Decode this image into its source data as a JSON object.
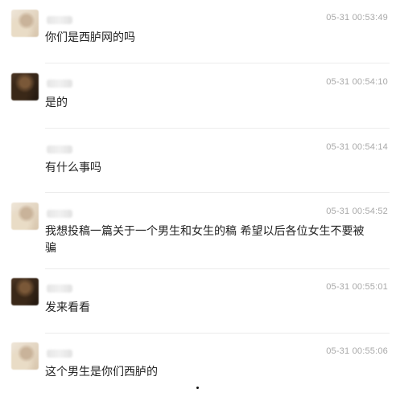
{
  "messages": [
    {
      "avatar": "light",
      "time": "05-31 00:53:49",
      "text": "你们是西胪网的吗"
    },
    {
      "avatar": "dark",
      "time": "05-31 00:54:10",
      "text": "是的"
    },
    {
      "avatar": "none",
      "time": "05-31 00:54:14",
      "text": "有什么事吗"
    },
    {
      "avatar": "light",
      "time": "05-31 00:54:52",
      "text": "我想投稿一篇关于一个男生和女生的稿 希望以后各位女生不要被骗"
    },
    {
      "avatar": "dark",
      "time": "05-31 00:55:01",
      "text": "发来看看"
    },
    {
      "avatar": "light",
      "time": "05-31 00:55:06",
      "text": "这个男生是你们西胪的"
    }
  ]
}
